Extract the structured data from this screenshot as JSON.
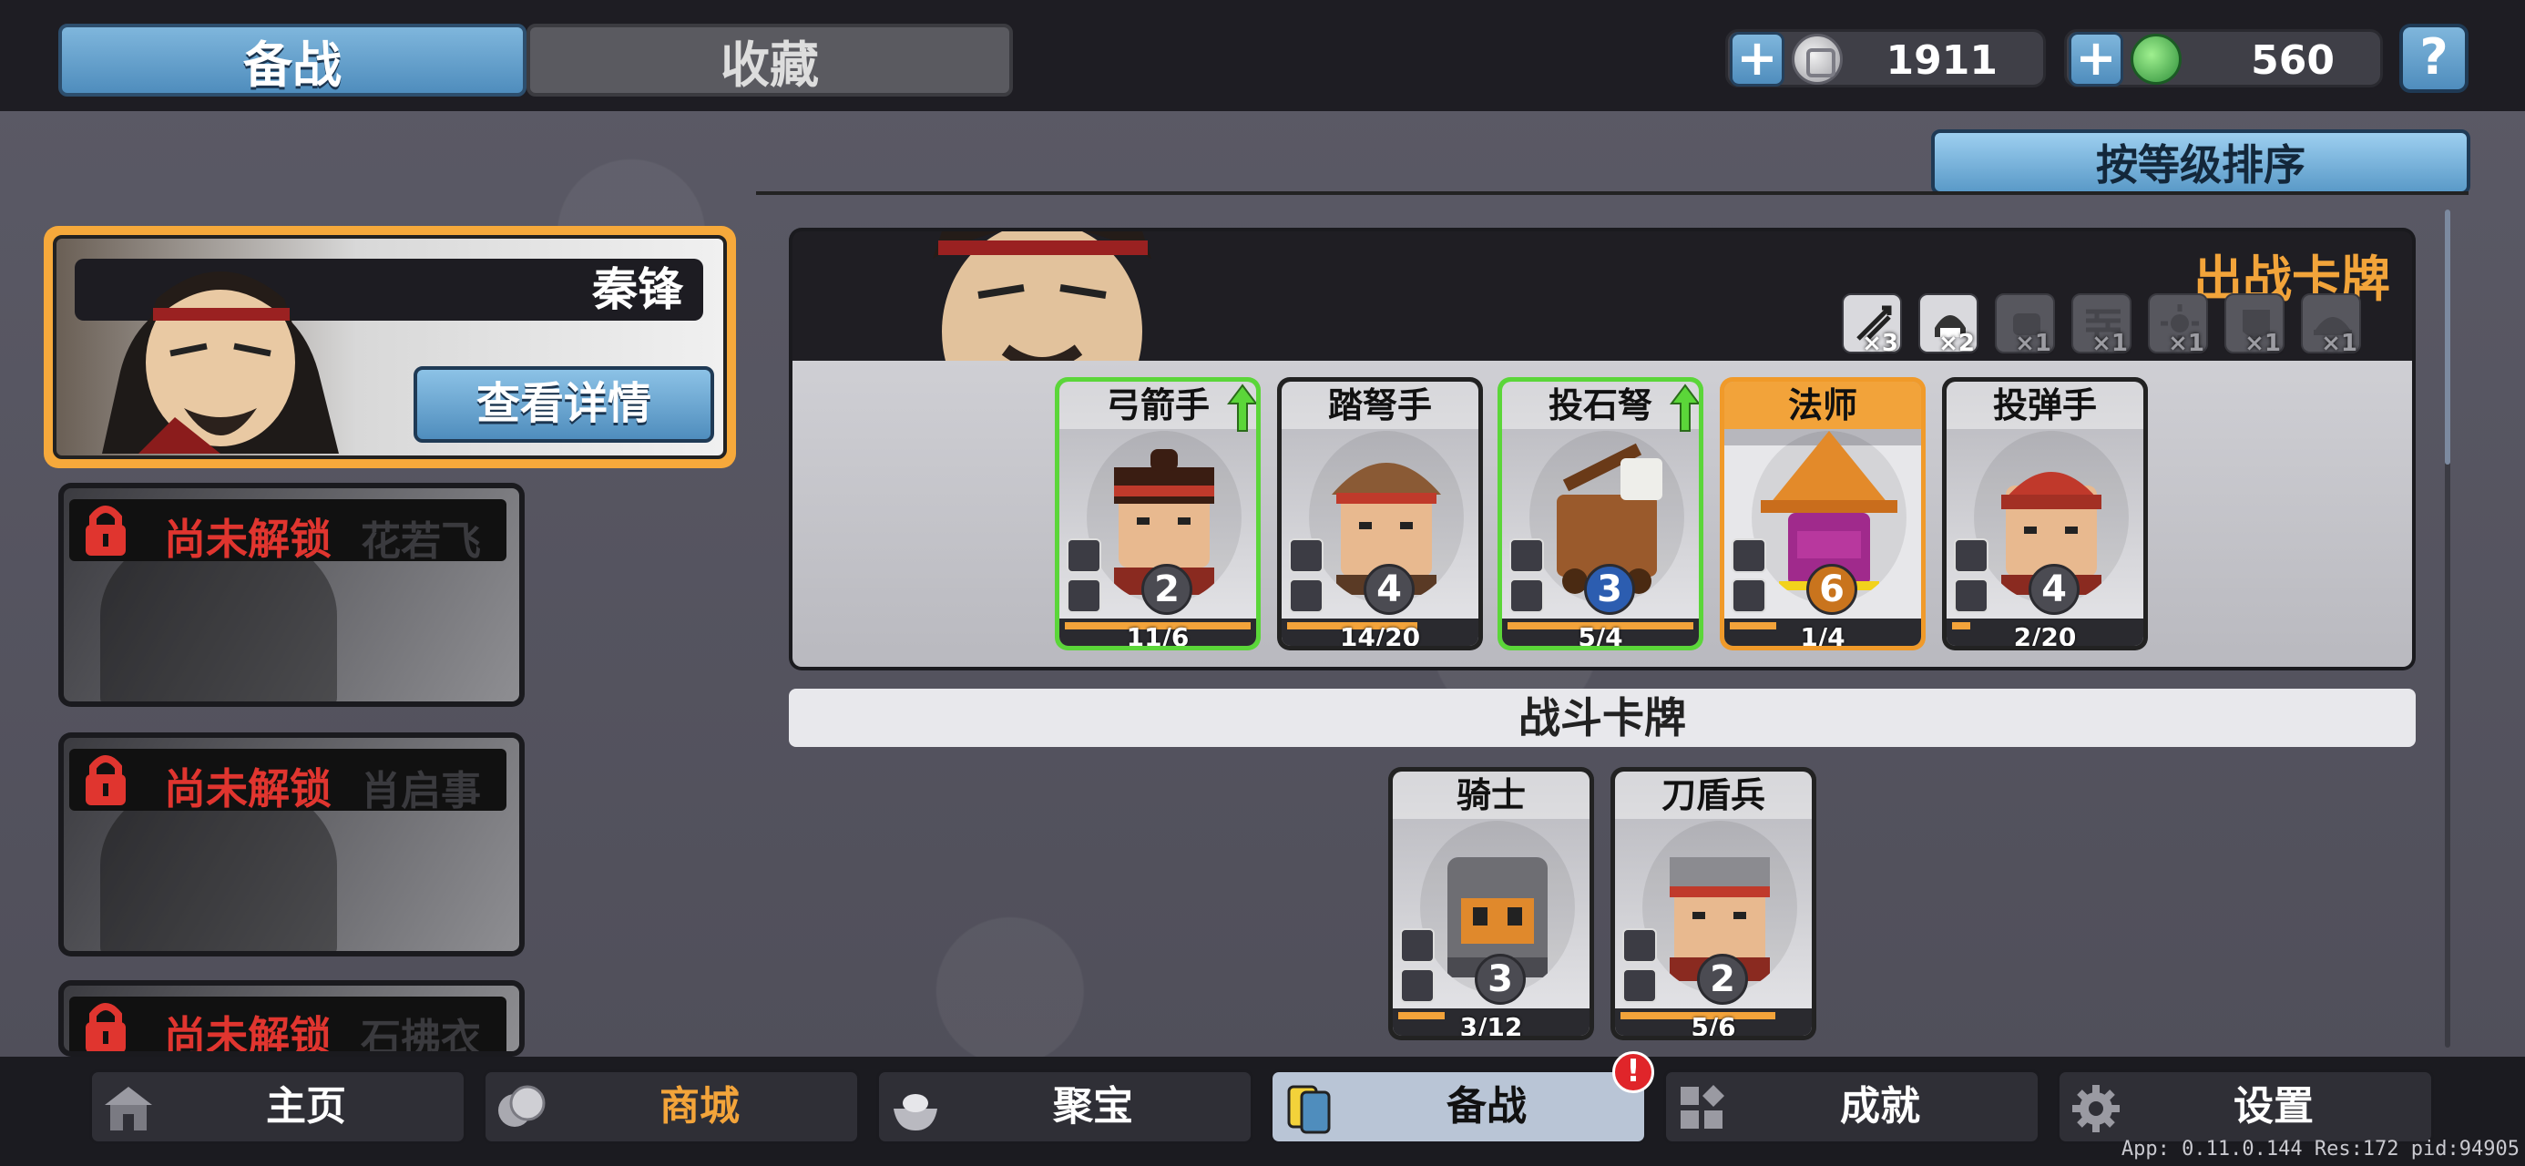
{
  "top_tabs": {
    "active": "备战",
    "inactive": "收藏"
  },
  "currency": {
    "silver": {
      "amount": "1911",
      "icon": "silver-coin-icon"
    },
    "jade": {
      "amount": "560",
      "icon": "jade-coin-icon"
    },
    "plus_symbol": "+",
    "help_symbol": "?"
  },
  "sort_button": "按等级排序",
  "selected_hero": {
    "name": "秦锋",
    "detail_button": "查看详情"
  },
  "locked_heroes": [
    {
      "lock_text": "尚未解锁",
      "name": "花若飞"
    },
    {
      "lock_text": "尚未解锁",
      "name": "肖启事"
    },
    {
      "lock_text": "尚未解锁",
      "name": "石拂衣"
    }
  ],
  "deck": {
    "title": "出战卡牌",
    "trait_chips": [
      {
        "icon": "arrows-icon",
        "count": "×3",
        "active": true
      },
      {
        "icon": "helmet-icon",
        "count": "×2",
        "active": true
      },
      {
        "icon": "fist-icon",
        "count": "×1",
        "active": false
      },
      {
        "icon": "wall-icon",
        "count": "×1",
        "active": false
      },
      {
        "icon": "burst-icon",
        "count": "×1",
        "active": false
      },
      {
        "icon": "mask-icon",
        "count": "×1",
        "active": false
      },
      {
        "icon": "hat-icon",
        "count": "×1",
        "active": false
      }
    ],
    "cards": [
      {
        "name": "弓箭手",
        "level": "2",
        "progress": "11/6",
        "fill": 1.0,
        "border": "green",
        "upgrade": true
      },
      {
        "name": "踏弩手",
        "level": "4",
        "progress": "14/20",
        "fill": 0.7,
        "border": "dark",
        "upgrade": false
      },
      {
        "name": "投石弩",
        "level": "3",
        "progress": "5/4",
        "fill": 1.0,
        "border": "green",
        "upgrade": true
      },
      {
        "name": "法师",
        "level": "6",
        "progress": "1/4",
        "fill": 0.25,
        "border": "orange",
        "upgrade": false
      },
      {
        "name": "投弹手",
        "level": "4",
        "progress": "2/20",
        "fill": 0.1,
        "border": "dark",
        "upgrade": false
      }
    ]
  },
  "battle_cards": {
    "title": "战斗卡牌",
    "cards": [
      {
        "name": "骑士",
        "level": "3",
        "progress": "3/12",
        "fill": 0.25
      },
      {
        "name": "刀盾兵",
        "level": "2",
        "progress": "5/6",
        "fill": 0.83
      }
    ]
  },
  "bottom_nav": [
    {
      "label": "主页",
      "icon": "home-icon"
    },
    {
      "label": "商城",
      "icon": "shop-coins-icon"
    },
    {
      "label": "聚宝",
      "icon": "treasure-bowl-icon"
    },
    {
      "label": "备战",
      "icon": "cards-icon",
      "active": true,
      "badge": "!"
    },
    {
      "label": "成就",
      "icon": "achievement-icon"
    },
    {
      "label": "设置",
      "icon": "gear-icon"
    }
  ],
  "app_info": "App: 0.11.0.144 Res:172 pid:94905"
}
